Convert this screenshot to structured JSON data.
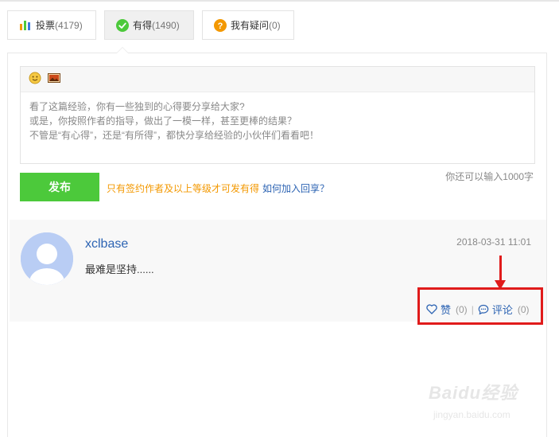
{
  "tabs": [
    {
      "label": "投票",
      "count": "(4179)",
      "icon": "bar-chart-icon"
    },
    {
      "label": "有得",
      "count": "(1490)",
      "icon": "check-circle-icon"
    },
    {
      "label": "我有疑问",
      "count": "(0)",
      "icon": "question-circle-icon"
    }
  ],
  "editor": {
    "toolbar": {
      "emoji_icon": "smiley-icon",
      "image_icon": "image-icon"
    },
    "placeholder_lines": [
      "看了这篇经验，你有一些独到的心得要分享给大家?",
      "或是，你按照作者的指导，做出了一模一样，甚至更棒的结果？",
      "不管是“有心得”，还是“有所得”，都快分享给经验的小伙伴们看看吧！"
    ]
  },
  "publish": {
    "button_label": "发布",
    "notice": "只有签约作者及以上等级才可发有得",
    "join_link": "如何加入回享？",
    "char_left": "你还可以输入1000字"
  },
  "comment": {
    "username": "xclbase",
    "timestamp": "2018-03-31 11:01",
    "text": "最难是坚持......",
    "like_label": "赞",
    "like_count": "(0)",
    "separator": "|",
    "reply_label": "评论",
    "reply_count": "(0)"
  },
  "watermark": {
    "logo": "Baidu经验",
    "url": "jingyan.baidu.com"
  },
  "colors": {
    "accent_green": "#4cc93b",
    "link_blue": "#2d64b3",
    "notice_orange": "#f39800",
    "annotation_red": "#e01b1b",
    "avatar_blue": "#b9cdf4"
  }
}
